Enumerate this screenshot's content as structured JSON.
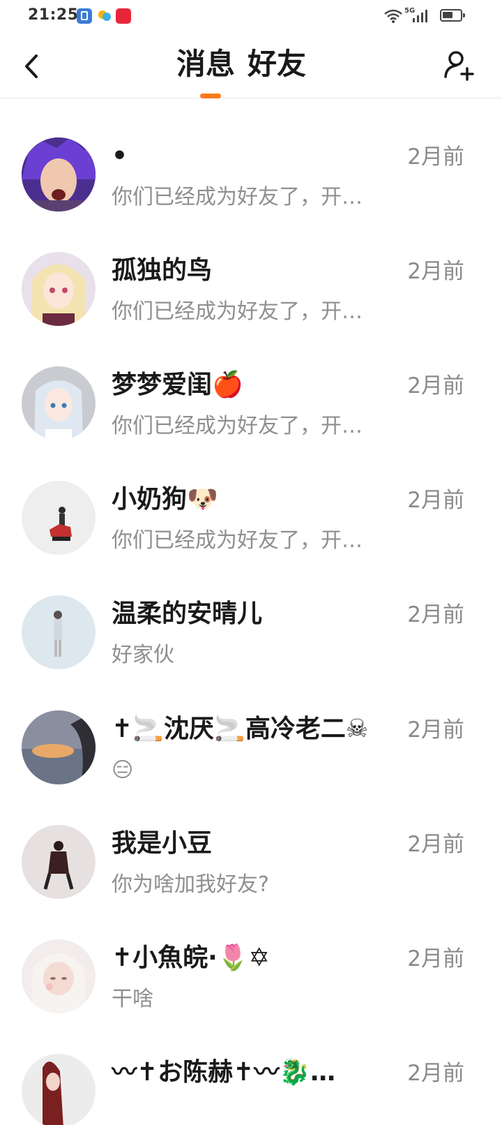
{
  "status_bar": {
    "time": "21:25",
    "network": "5G"
  },
  "nav": {
    "tabs": [
      {
        "label": "消息",
        "active": true
      },
      {
        "label": "好友",
        "active": false
      }
    ],
    "accent_color": "#ff7a1a"
  },
  "conversations": [
    {
      "name": "•",
      "preview": "你们已经成为好友了，开…",
      "time": "2月前",
      "avatar": "purple-hair-avatar"
    },
    {
      "name": "孤独的鸟",
      "preview": "你们已经成为好友了，开…",
      "time": "2月前",
      "avatar": "anime-blonde-avatar"
    },
    {
      "name": "梦梦爱闺🍎",
      "preview": "你们已经成为好友了，开…",
      "time": "2月前",
      "avatar": "anime-silver-avatar"
    },
    {
      "name": "小奶狗🐶",
      "preview": "你们已经成为好友了，开…",
      "time": "2月前",
      "avatar": "figure-avatar"
    },
    {
      "name": "温柔的安晴儿",
      "preview": "好家伙",
      "time": "2月前",
      "avatar": "figure-light-avatar"
    },
    {
      "name": "✝🚬沈厌🚬高冷老二☠",
      "preview": "😑",
      "time": "2月前",
      "avatar": "sunset-hands-avatar"
    },
    {
      "name": "我是小豆",
      "preview": "你为啥加我好友?",
      "time": "2月前",
      "avatar": "figure-dark-avatar"
    },
    {
      "name": "✝小魚皖·🌷✡",
      "preview": "干啥",
      "time": "2月前",
      "avatar": "doll-avatar"
    },
    {
      "name": "〰✝お陈赫✝〰🐉…",
      "preview": "",
      "time": "2月前",
      "avatar": "figure-red-avatar"
    }
  ]
}
